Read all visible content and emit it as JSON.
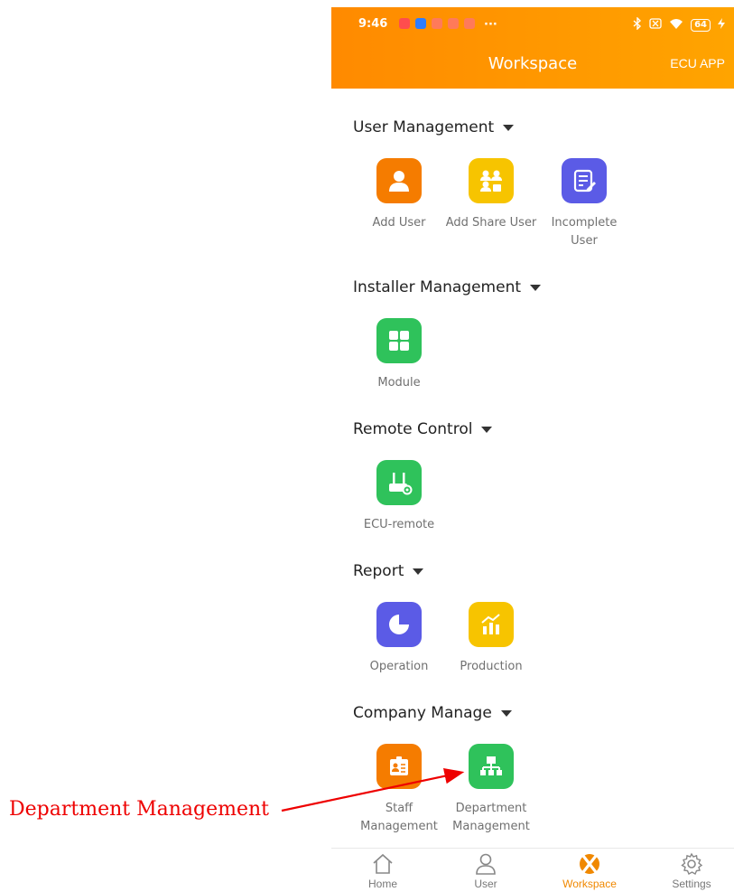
{
  "status_bar": {
    "time": "9:46",
    "dots": "···",
    "battery": "64"
  },
  "header": {
    "title": "Workspace",
    "action_label": "ECU APP",
    "gradient_start": "#ff8a00",
    "gradient_end": "#ffa400"
  },
  "sections": {
    "user_management": {
      "title": "User Management",
      "items": [
        {
          "label": "Add User",
          "icon": "person-icon",
          "color": "#f57c00"
        },
        {
          "label": "Add Share User",
          "icon": "share-users-icon",
          "color": "#f7c400"
        },
        {
          "label": "Incomplete\nUser",
          "icon": "edit-list-icon",
          "color": "#5b5be6"
        }
      ]
    },
    "installer_management": {
      "title": "Installer Management",
      "items": [
        {
          "label": "Module",
          "icon": "grid-icon",
          "color": "#2fc25b"
        }
      ]
    },
    "remote_control": {
      "title": "Remote Control",
      "items": [
        {
          "label": "ECU-remote",
          "icon": "router-gear-icon",
          "color": "#2fc25b"
        }
      ]
    },
    "report": {
      "title": "Report",
      "items": [
        {
          "label": "Operation",
          "icon": "pie-icon",
          "color": "#5b5be6"
        },
        {
          "label": "Production",
          "icon": "bar-trend-icon",
          "color": "#f7c400"
        }
      ]
    },
    "company_manage": {
      "title": "Company Manage",
      "items": [
        {
          "label": "Staff\nManagement",
          "icon": "id-badge-icon",
          "color": "#f57c00"
        },
        {
          "label": "Department\nManagement",
          "icon": "org-chart-icon",
          "color": "#2fc25b"
        }
      ]
    }
  },
  "bottom_nav": {
    "items": [
      {
        "label": "Home",
        "icon": "home-icon"
      },
      {
        "label": "User",
        "icon": "user-icon"
      },
      {
        "label": "Workspace",
        "icon": "workspace-icon",
        "active": true
      },
      {
        "label": "Settings",
        "icon": "gear-icon"
      }
    ],
    "active_color": "#f08800"
  },
  "annotation": {
    "text": "Department Management",
    "color": "#ee0000"
  }
}
